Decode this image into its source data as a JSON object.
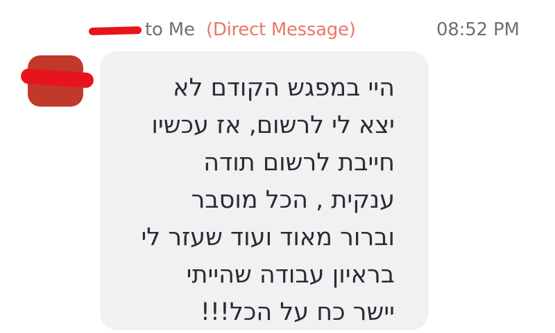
{
  "message": {
    "recipient_text": "to Me",
    "message_type": "(Direct Message)",
    "timestamp": "08:52 PM",
    "body": "היי במפגש הקודם לא\nיצא לי לרשום, אז עכשיו\nחייבת לרשום תודה\nענקית , הכל מוסבר\nוברור מאוד ועוד שעזר לי\nבראיון עבודה שהייתי\nיישר כח על הכל!!!"
  },
  "colors": {
    "redaction": "#e8141b",
    "avatar": "#c0392b",
    "direct_message_accent": "#e8776b",
    "bubble_background": "#f1f1f4",
    "meta_text": "#6e6e78"
  }
}
